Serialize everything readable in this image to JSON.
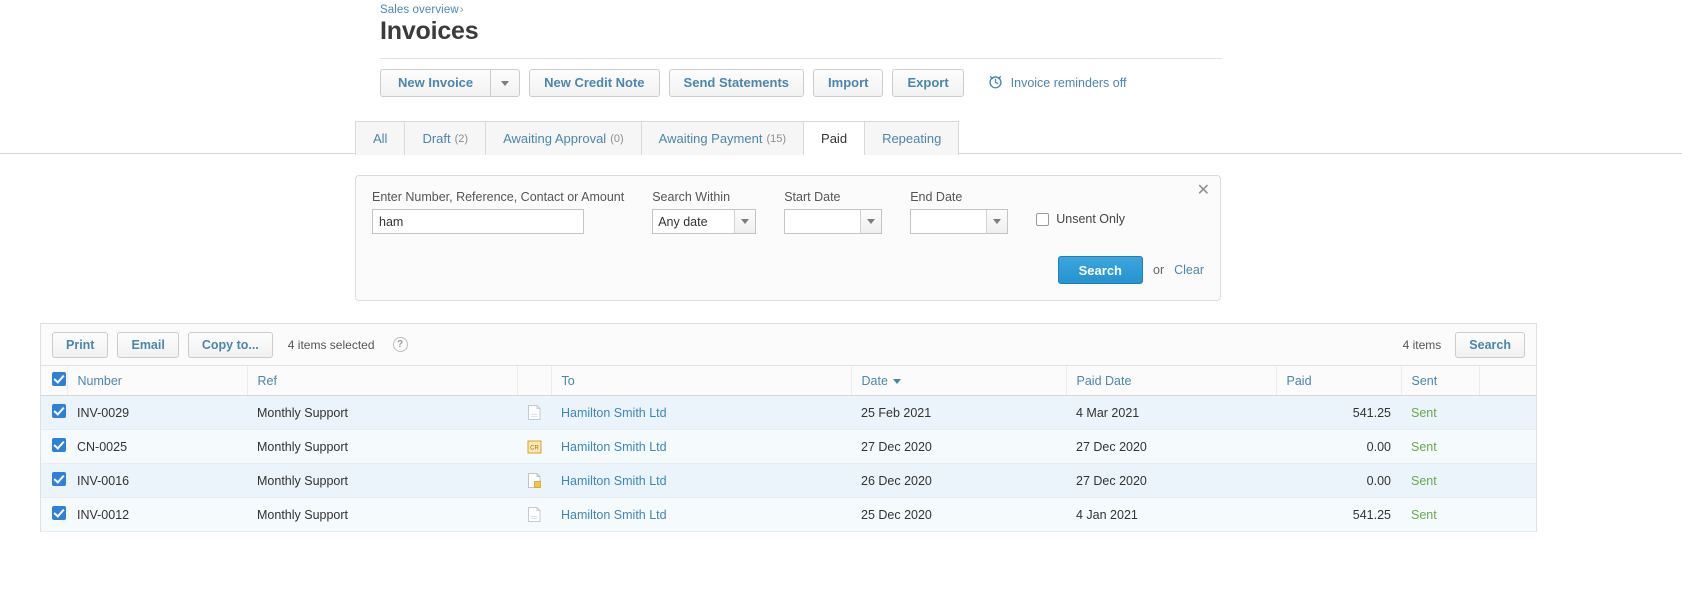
{
  "header": {
    "breadcrumb_label": "Sales overview",
    "breadcrumb_separator": "›",
    "title": "Invoices"
  },
  "toolbar": {
    "new_invoice_label": "New Invoice",
    "new_invoice_caret_icon": "chevron-down-icon",
    "new_credit_note_label": "New Credit Note",
    "send_statements_label": "Send Statements",
    "import_label": "Import",
    "export_label": "Export",
    "reminders_icon": "alarm-clock-icon",
    "reminders_label": "Invoice reminders off"
  },
  "tabs": [
    {
      "label": "All",
      "count": "",
      "active": false
    },
    {
      "label": "Draft",
      "count": "(2)",
      "active": false
    },
    {
      "label": "Awaiting Approval",
      "count": "(0)",
      "active": false
    },
    {
      "label": "Awaiting Payment",
      "count": "(15)",
      "active": false
    },
    {
      "label": "Paid",
      "count": "",
      "active": true
    },
    {
      "label": "Repeating",
      "count": "",
      "active": false
    }
  ],
  "search_panel": {
    "close_icon": "close-icon",
    "query_label": "Enter Number, Reference, Contact or Amount",
    "query_value": "ham",
    "within_label": "Search Within",
    "within_value": "Any date",
    "start_date_label": "Start Date",
    "start_date_value": "",
    "end_date_label": "End Date",
    "end_date_value": "",
    "unsent_label": "Unsent Only",
    "unsent_checked": false,
    "search_label": "Search",
    "or_label": "or",
    "clear_label": "Clear"
  },
  "action_bar": {
    "print_label": "Print",
    "email_label": "Email",
    "copy_to_label": "Copy to...",
    "selected_text": "4 items selected",
    "help_icon_label": "?",
    "items_total": "4 items",
    "search_label": "Search"
  },
  "table": {
    "columns": [
      "Number",
      "Ref",
      "To",
      "Date",
      "Paid Date",
      "Paid",
      "Sent"
    ],
    "sort_column": "Date",
    "sort_direction": "desc",
    "header_checkbox_checked": true,
    "rows": [
      {
        "checked": true,
        "number": "INV-0029",
        "ref": "Monthly Support",
        "doc_icon": "document-icon",
        "to": "Hamilton Smith Ltd",
        "date": "25 Feb 2021",
        "paid_date": "4 Mar 2021",
        "paid": "541.25",
        "sent": "Sent"
      },
      {
        "checked": true,
        "number": "CN-0025",
        "ref": "Monthly Support",
        "doc_icon": "credit-note-icon",
        "to": "Hamilton Smith Ltd",
        "date": "27 Dec 2020",
        "paid_date": "27 Dec 2020",
        "paid": "0.00",
        "sent": "Sent"
      },
      {
        "checked": true,
        "number": "INV-0016",
        "ref": "Monthly Support",
        "doc_icon": "document-credited-icon",
        "to": "Hamilton Smith Ltd",
        "date": "26 Dec 2020",
        "paid_date": "27 Dec 2020",
        "paid": "0.00",
        "sent": "Sent"
      },
      {
        "checked": true,
        "number": "INV-0012",
        "ref": "Monthly Support",
        "doc_icon": "document-icon",
        "to": "Hamilton Smith Ltd",
        "date": "25 Dec 2020",
        "paid_date": "4 Jan 2021",
        "paid": "541.25",
        "sent": "Sent"
      }
    ]
  },
  "colors": {
    "link": "#4a87ad",
    "primary": "#2493cf",
    "sent": "#6aa84f",
    "row_highlight": "#eaf4fa"
  }
}
